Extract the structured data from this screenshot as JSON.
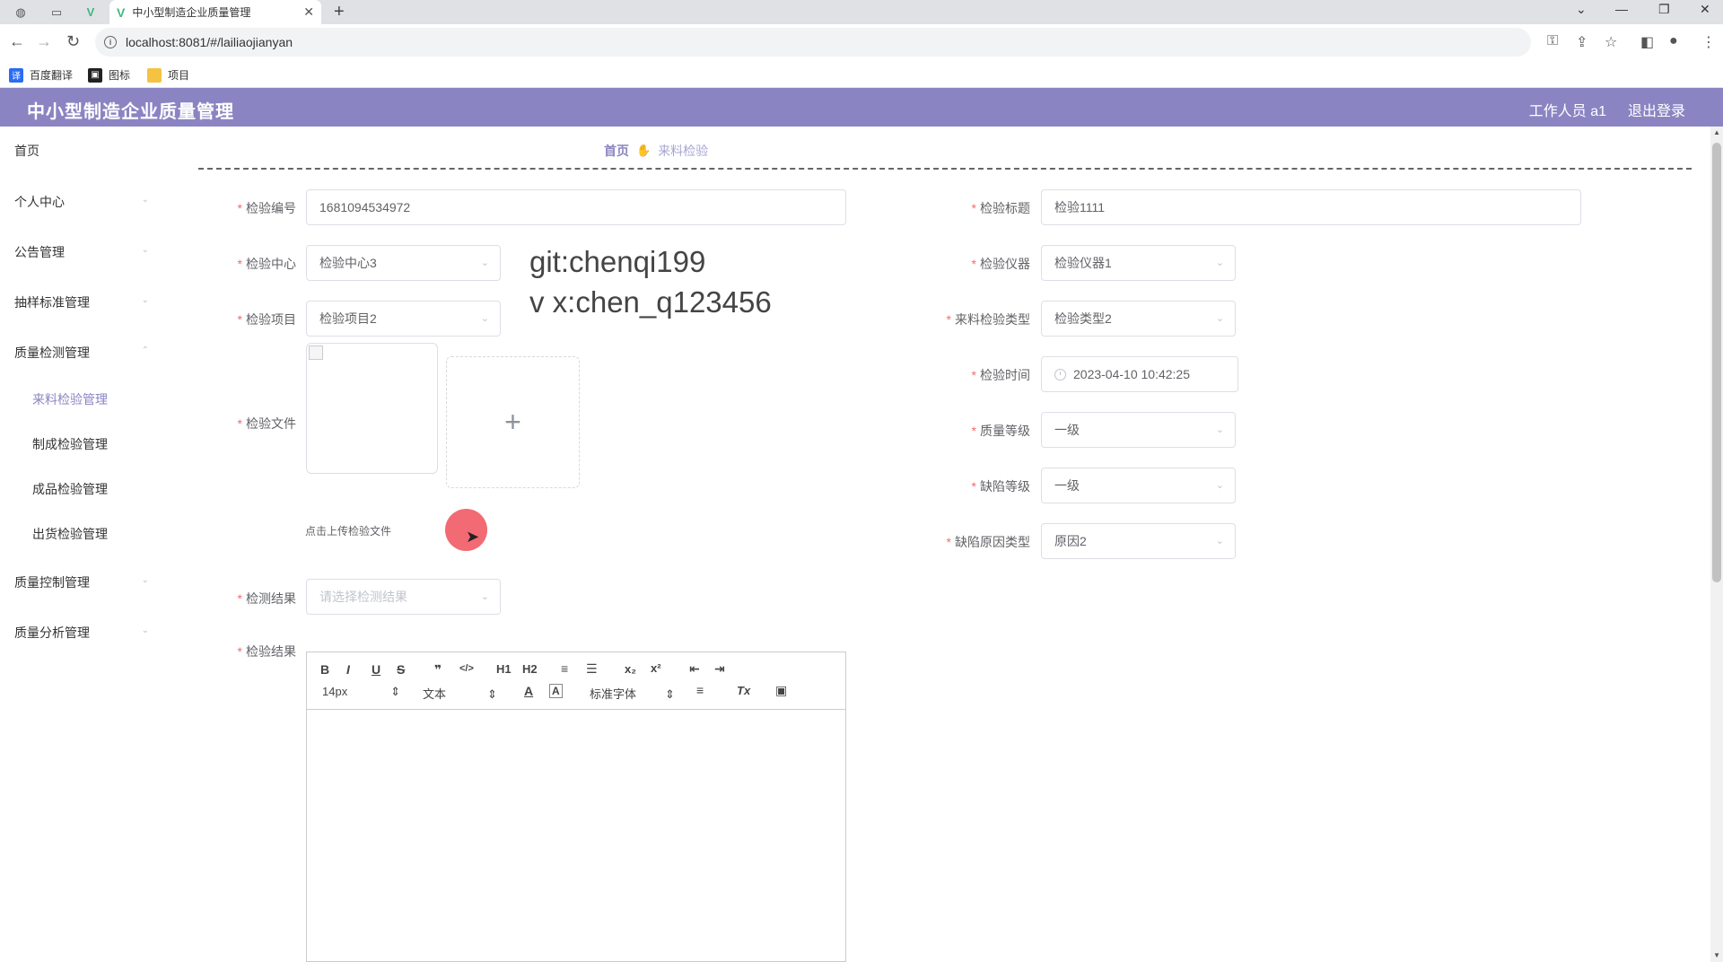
{
  "browser": {
    "tab_title": "中小型制造企业质量管理",
    "url": "localhost:8081/#/lailiaojianyan",
    "new_tab": "+",
    "bookmarks": [
      {
        "label": "百度翻译",
        "color": "#2b6df2",
        "icon": "translate-icon"
      },
      {
        "label": "图标",
        "color": "#222222",
        "icon": "image-icon"
      },
      {
        "label": "项目",
        "color": "#f5c242",
        "icon": "folder-icon"
      }
    ]
  },
  "header": {
    "title": "中小型制造企业质量管理",
    "user": "工作人员 a1",
    "logout": "退出登录",
    "color": "#8a85c2"
  },
  "sidebar": {
    "items": [
      {
        "label": "首页"
      },
      {
        "label": "个人中心"
      },
      {
        "label": "公告管理"
      },
      {
        "label": "抽样标准管理"
      },
      {
        "label": "质量检测管理"
      },
      {
        "label": "质量控制管理"
      },
      {
        "label": "质量分析管理"
      }
    ],
    "subitems": [
      {
        "label": "来料检验管理",
        "active": true
      },
      {
        "label": "制成检验管理"
      },
      {
        "label": "成品检验管理"
      },
      {
        "label": "出货检验管理"
      }
    ]
  },
  "breadcrumb": {
    "home": "首页",
    "current": "来料检验"
  },
  "form": {
    "inspection_no": {
      "label": "检验编号",
      "value": "1681094534972"
    },
    "inspection_center": {
      "label": "检验中心",
      "value": "检验中心3"
    },
    "inspection_item": {
      "label": "检验项目",
      "value": "检验项目2"
    },
    "inspection_file": {
      "label": "检验文件",
      "upload_plus": "+",
      "tip": "点击上传检验文件"
    },
    "detect_result": {
      "label": "检测结果",
      "placeholder": "请选择检测结果"
    },
    "inspection_result": {
      "label": "检验结果"
    },
    "inspection_title": {
      "label": "检验标题",
      "value": "检验1111"
    },
    "inspection_instrument": {
      "label": "检验仪器",
      "value": "检验仪器1"
    },
    "incoming_type": {
      "label": "来料检验类型",
      "value": "检验类型2"
    },
    "inspection_time": {
      "label": "检验时间",
      "value": "2023-04-10 10:42:25"
    },
    "quality_level": {
      "label": "质量等级",
      "value": "一级"
    },
    "defect_level": {
      "label": "缺陷等级",
      "value": "一级"
    },
    "defect_cause": {
      "label": "缺陷原因类型",
      "value": "原因2"
    }
  },
  "watermark": {
    "line1": "git:chenqi199",
    "line2": "v x:chen_q123456"
  },
  "editor": {
    "font_size": "14px",
    "paragraph": "文本",
    "font_family": "标准字体",
    "buttons": {
      "bold": "B",
      "italic": "I",
      "underline": "U",
      "strike": "S",
      "quote": "❞",
      "code": "</>",
      "h1": "H1",
      "h2": "H2",
      "ol": "≡",
      "ul": "☰",
      "sub": "x₂",
      "sup": "x²",
      "outdent": "⇤",
      "indent": "⇥",
      "color": "A",
      "bg": "A",
      "align": "≡",
      "clean": "Tx",
      "image": "▣"
    }
  }
}
